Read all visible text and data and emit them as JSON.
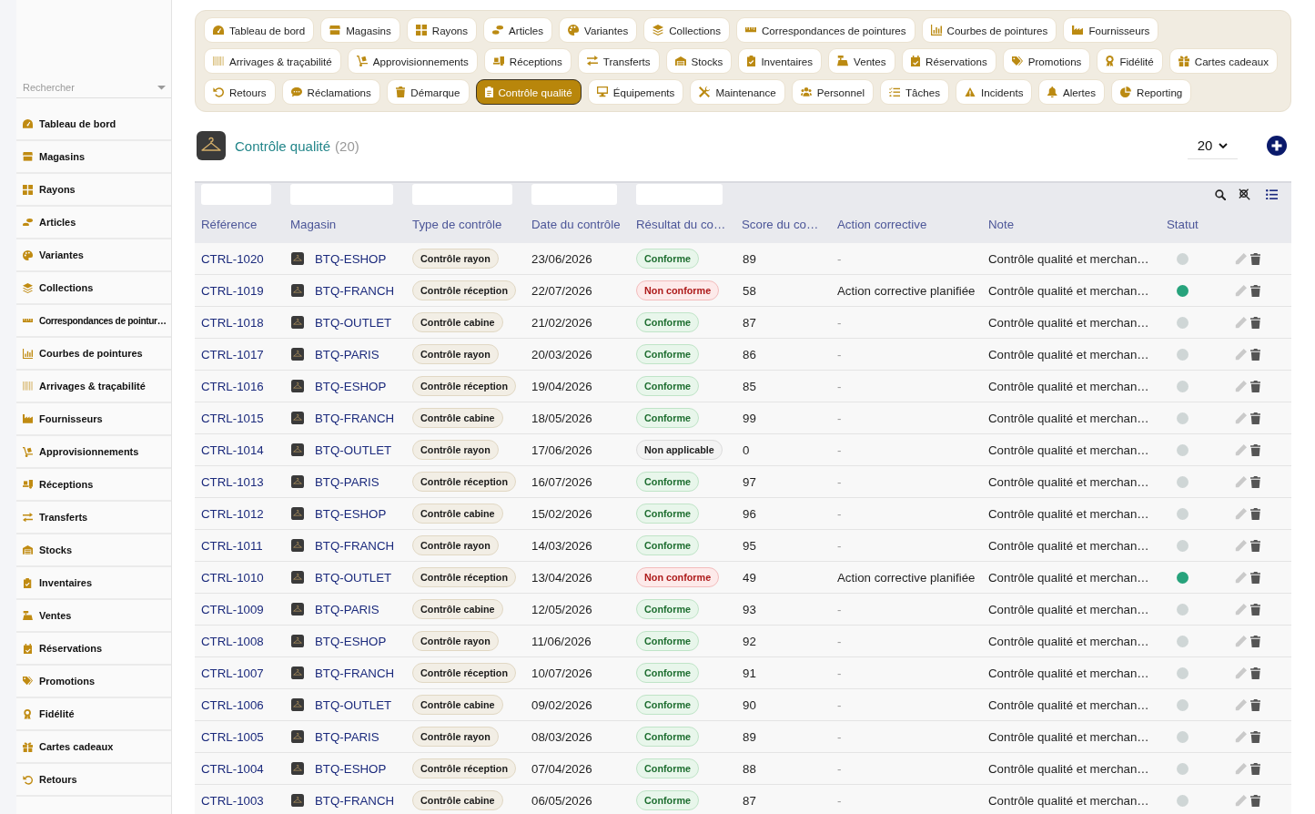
{
  "sidebar": {
    "search": {
      "placeholder": "Rechercher"
    },
    "items": [
      {
        "label": "Tableau de bord"
      },
      {
        "label": "Magasins"
      },
      {
        "label": "Rayons"
      },
      {
        "label": "Articles"
      },
      {
        "label": "Variantes"
      },
      {
        "label": "Collections"
      },
      {
        "label": "Correspondances de pointur…"
      },
      {
        "label": "Courbes de pointures"
      },
      {
        "label": "Arrivages & traçabilité"
      },
      {
        "label": "Fournisseurs"
      },
      {
        "label": "Approvisionnements"
      },
      {
        "label": "Réceptions"
      },
      {
        "label": "Transferts"
      },
      {
        "label": "Stocks"
      },
      {
        "label": "Inventaires"
      },
      {
        "label": "Ventes"
      },
      {
        "label": "Réservations"
      },
      {
        "label": "Promotions"
      },
      {
        "label": "Fidélité"
      },
      {
        "label": "Cartes cadeaux"
      },
      {
        "label": "Retours"
      }
    ]
  },
  "top_nav": {
    "rows": [
      {
        "items": [
          {
            "label": "Tableau de bord",
            "selected": false
          },
          {
            "label": "Magasins",
            "selected": false
          },
          {
            "label": "Rayons",
            "selected": false
          },
          {
            "label": "Articles",
            "selected": false
          },
          {
            "label": "Variantes",
            "selected": false
          },
          {
            "label": "Collections",
            "selected": false
          },
          {
            "label": "Correspondances de pointures",
            "selected": false
          },
          {
            "label": "Courbes de pointures",
            "selected": false
          },
          {
            "label": "Fournisseurs",
            "selected": false
          }
        ]
      },
      {
        "items": [
          {
            "label": "Arrivages & traçabilité",
            "selected": false
          },
          {
            "label": "Approvisionnements",
            "selected": false
          },
          {
            "label": "Réceptions",
            "selected": false
          },
          {
            "label": "Transferts",
            "selected": false
          },
          {
            "label": "Stocks",
            "selected": false
          },
          {
            "label": "Inventaires",
            "selected": false
          },
          {
            "label": "Ventes",
            "selected": false
          },
          {
            "label": "Réservations",
            "selected": false
          },
          {
            "label": "Promotions",
            "selected": false
          },
          {
            "label": "Fidélité",
            "selected": false
          },
          {
            "label": "Cartes cadeaux",
            "selected": false
          }
        ]
      },
      {
        "items": [
          {
            "label": "Retours",
            "selected": false
          },
          {
            "label": "Réclamations",
            "selected": false
          },
          {
            "label": "Démarque",
            "selected": false
          },
          {
            "label": "Contrôle qualité",
            "selected": true
          },
          {
            "label": "Équipements",
            "selected": false
          },
          {
            "label": "Maintenance",
            "selected": false
          },
          {
            "label": "Personnel",
            "selected": false
          },
          {
            "label": "Tâches",
            "selected": false
          },
          {
            "label": "Incidents",
            "selected": false
          },
          {
            "label": "Alertes",
            "selected": false
          },
          {
            "label": "Reporting",
            "selected": false
          }
        ]
      }
    ]
  },
  "header": {
    "title": "Contrôle qualité",
    "count": "(20)",
    "page_size": "20"
  },
  "table": {
    "columns": [
      {
        "label": "Référence",
        "filterable": true
      },
      {
        "label": "Magasin",
        "filterable": true
      },
      {
        "label": "Type de contrôle",
        "filterable": true
      },
      {
        "label": "Date du contrôle",
        "filterable": true
      },
      {
        "label": "Résultat du co…",
        "filterable": true
      },
      {
        "label": "Score du co…",
        "filterable": false
      },
      {
        "label": "Action corrective",
        "filterable": false
      },
      {
        "label": "Note",
        "filterable": false
      },
      {
        "label": "Statut",
        "filterable": false
      }
    ],
    "rows": [
      {
        "reference": "CTRL-1020",
        "store": "BTQ-ESHOP",
        "type": "Contrôle rayon",
        "date": "23/06/2026",
        "result": {
          "label": "Conforme",
          "kind": "pass"
        },
        "score": "89",
        "action": {
          "text": "-",
          "muted": true
        },
        "note": "Contrôle qualité et merchan…",
        "status": {
          "color": "#cfd6d6"
        }
      },
      {
        "reference": "CTRL-1019",
        "store": "BTQ-FRANCH",
        "type": "Contrôle réception",
        "date": "22/07/2026",
        "result": {
          "label": "Non conforme",
          "kind": "fail"
        },
        "score": "58",
        "action": {
          "text": "Action corrective planifiée",
          "muted": false
        },
        "note": "Contrôle qualité et merchan…",
        "status": {
          "color": "#27a37c"
        }
      },
      {
        "reference": "CTRL-1018",
        "store": "BTQ-OUTLET",
        "type": "Contrôle cabine",
        "date": "21/02/2026",
        "result": {
          "label": "Conforme",
          "kind": "pass"
        },
        "score": "87",
        "action": {
          "text": "-",
          "muted": true
        },
        "note": "Contrôle qualité et merchan…",
        "status": {
          "color": "#cfd6d6"
        }
      },
      {
        "reference": "CTRL-1017",
        "store": "BTQ-PARIS",
        "type": "Contrôle rayon",
        "date": "20/03/2026",
        "result": {
          "label": "Conforme",
          "kind": "pass"
        },
        "score": "86",
        "action": {
          "text": "-",
          "muted": true
        },
        "note": "Contrôle qualité et merchan…",
        "status": {
          "color": "#cfd6d6"
        }
      },
      {
        "reference": "CTRL-1016",
        "store": "BTQ-ESHOP",
        "type": "Contrôle réception",
        "date": "19/04/2026",
        "result": {
          "label": "Conforme",
          "kind": "pass"
        },
        "score": "85",
        "action": {
          "text": "-",
          "muted": true
        },
        "note": "Contrôle qualité et merchan…",
        "status": {
          "color": "#cfd6d6"
        }
      },
      {
        "reference": "CTRL-1015",
        "store": "BTQ-FRANCH",
        "type": "Contrôle cabine",
        "date": "18/05/2026",
        "result": {
          "label": "Conforme",
          "kind": "pass"
        },
        "score": "99",
        "action": {
          "text": "-",
          "muted": true
        },
        "note": "Contrôle qualité et merchan…",
        "status": {
          "color": "#cfd6d6"
        }
      },
      {
        "reference": "CTRL-1014",
        "store": "BTQ-OUTLET",
        "type": "Contrôle rayon",
        "date": "17/06/2026",
        "result": {
          "label": "Non applicable",
          "kind": "na"
        },
        "score": "0",
        "action": {
          "text": "-",
          "muted": true
        },
        "note": "Contrôle qualité et merchan…",
        "status": {
          "color": "#cfd6d6"
        }
      },
      {
        "reference": "CTRL-1013",
        "store": "BTQ-PARIS",
        "type": "Contrôle réception",
        "date": "16/07/2026",
        "result": {
          "label": "Conforme",
          "kind": "pass"
        },
        "score": "97",
        "action": {
          "text": "-",
          "muted": true
        },
        "note": "Contrôle qualité et merchan…",
        "status": {
          "color": "#cfd6d6"
        }
      },
      {
        "reference": "CTRL-1012",
        "store": "BTQ-ESHOP",
        "type": "Contrôle cabine",
        "date": "15/02/2026",
        "result": {
          "label": "Conforme",
          "kind": "pass"
        },
        "score": "96",
        "action": {
          "text": "-",
          "muted": true
        },
        "note": "Contrôle qualité et merchan…",
        "status": {
          "color": "#cfd6d6"
        }
      },
      {
        "reference": "CTRL-1011",
        "store": "BTQ-FRANCH",
        "type": "Contrôle rayon",
        "date": "14/03/2026",
        "result": {
          "label": "Conforme",
          "kind": "pass"
        },
        "score": "95",
        "action": {
          "text": "-",
          "muted": true
        },
        "note": "Contrôle qualité et merchan…",
        "status": {
          "color": "#cfd6d6"
        }
      },
      {
        "reference": "CTRL-1010",
        "store": "BTQ-OUTLET",
        "type": "Contrôle réception",
        "date": "13/04/2026",
        "result": {
          "label": "Non conforme",
          "kind": "fail"
        },
        "score": "49",
        "action": {
          "text": "Action corrective planifiée",
          "muted": false
        },
        "note": "Contrôle qualité et merchan…",
        "status": {
          "color": "#27a37c"
        }
      },
      {
        "reference": "CTRL-1009",
        "store": "BTQ-PARIS",
        "type": "Contrôle cabine",
        "date": "12/05/2026",
        "result": {
          "label": "Conforme",
          "kind": "pass"
        },
        "score": "93",
        "action": {
          "text": "-",
          "muted": true
        },
        "note": "Contrôle qualité et merchan…",
        "status": {
          "color": "#cfd6d6"
        }
      },
      {
        "reference": "CTRL-1008",
        "store": "BTQ-ESHOP",
        "type": "Contrôle rayon",
        "date": "11/06/2026",
        "result": {
          "label": "Conforme",
          "kind": "pass"
        },
        "score": "92",
        "action": {
          "text": "-",
          "muted": true
        },
        "note": "Contrôle qualité et merchan…",
        "status": {
          "color": "#cfd6d6"
        }
      },
      {
        "reference": "CTRL-1007",
        "store": "BTQ-FRANCH",
        "type": "Contrôle réception",
        "date": "10/07/2026",
        "result": {
          "label": "Conforme",
          "kind": "pass"
        },
        "score": "91",
        "action": {
          "text": "-",
          "muted": true
        },
        "note": "Contrôle qualité et merchan…",
        "status": {
          "color": "#cfd6d6"
        }
      },
      {
        "reference": "CTRL-1006",
        "store": "BTQ-OUTLET",
        "type": "Contrôle cabine",
        "date": "09/02/2026",
        "result": {
          "label": "Conforme",
          "kind": "pass"
        },
        "score": "90",
        "action": {
          "text": "-",
          "muted": true
        },
        "note": "Contrôle qualité et merchan…",
        "status": {
          "color": "#cfd6d6"
        }
      },
      {
        "reference": "CTRL-1005",
        "store": "BTQ-PARIS",
        "type": "Contrôle rayon",
        "date": "08/03/2026",
        "result": {
          "label": "Conforme",
          "kind": "pass"
        },
        "score": "89",
        "action": {
          "text": "-",
          "muted": true
        },
        "note": "Contrôle qualité et merchan…",
        "status": {
          "color": "#cfd6d6"
        }
      },
      {
        "reference": "CTRL-1004",
        "store": "BTQ-ESHOP",
        "type": "Contrôle réception",
        "date": "07/04/2026",
        "result": {
          "label": "Conforme",
          "kind": "pass"
        },
        "score": "88",
        "action": {
          "text": "-",
          "muted": true
        },
        "note": "Contrôle qualité et merchan…",
        "status": {
          "color": "#cfd6d6"
        }
      },
      {
        "reference": "CTRL-1003",
        "store": "BTQ-FRANCH",
        "type": "Contrôle cabine",
        "date": "06/05/2026",
        "result": {
          "label": "Conforme",
          "kind": "pass"
        },
        "score": "87",
        "action": {
          "text": "-",
          "muted": true
        },
        "note": "Contrôle qualité et merchan…",
        "status": {
          "color": "#cfd6d6"
        }
      }
    ]
  }
}
